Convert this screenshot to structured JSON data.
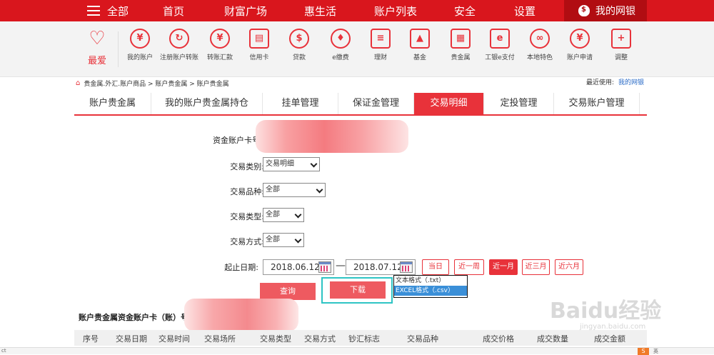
{
  "topnav": {
    "all_label": "全部",
    "items": [
      "首页",
      "财富广场",
      "惠生活",
      "账户列表",
      "安全",
      "设置"
    ],
    "mybank_label": "我的网银"
  },
  "quick": {
    "fav_label": "最爱",
    "items": [
      {
        "label": "我的账户",
        "icon": "yen-icon"
      },
      {
        "label": "注册账户转账",
        "icon": "transfer-icon"
      },
      {
        "label": "转账汇款",
        "icon": "remit-icon"
      },
      {
        "label": "信用卡",
        "icon": "credit-card-icon"
      },
      {
        "label": "贷款",
        "icon": "money-bag-icon"
      },
      {
        "label": "e缴费",
        "icon": "drop-icon"
      },
      {
        "label": "理财",
        "icon": "finance-icon"
      },
      {
        "label": "基金",
        "icon": "fund-chart-icon"
      },
      {
        "label": "贵金属",
        "icon": "gold-bars-icon"
      },
      {
        "label": "工银e支付",
        "icon": "epay-icon"
      },
      {
        "label": "本地特色",
        "icon": "local-icon"
      },
      {
        "label": "账户申请",
        "icon": "apply-icon"
      },
      {
        "label": "调整",
        "icon": "plus-icon"
      }
    ]
  },
  "breadcrumb": "贵金属.外汇.账户商品 > 账户贵金属 > 账户贵金属",
  "recent": {
    "label": "最近使用:",
    "link": "我的网银"
  },
  "tabs": [
    {
      "label": "账户贵金属",
      "active": false
    },
    {
      "label": "我的账户贵金属持仓",
      "active": false
    },
    {
      "label": "挂单管理",
      "active": false
    },
    {
      "label": "保证金管理",
      "active": false
    },
    {
      "label": "交易明细",
      "active": true
    },
    {
      "label": "定投管理",
      "active": false
    },
    {
      "label": "交易账户管理",
      "active": false
    }
  ],
  "form": {
    "account_label": "资金账户卡号",
    "trade_class_label": "交易类别:",
    "trade_class_value": "交易明细",
    "variety_label": "交易品种:",
    "variety_value": "全部",
    "trade_type_label": "交易类型:",
    "trade_type_value": "全部",
    "trade_method_label": "交易方式:",
    "trade_method_value": "全部",
    "date_label": "起止日期:",
    "start_date": "2018.06.12",
    "end_date": "2018.07.12",
    "date_sep": "—",
    "quick_ranges": [
      {
        "label": "当日",
        "active": false
      },
      {
        "label": "近一周",
        "active": false
      },
      {
        "label": "近一月",
        "active": true
      },
      {
        "label": "近三月",
        "active": false
      },
      {
        "label": "近六月",
        "active": false
      }
    ],
    "query_btn": "查询",
    "download_btn": "下载",
    "download_options": [
      "文本格式（.txt）",
      "EXCEL格式（.csv）"
    ],
    "download_selected": 1
  },
  "section_title": "账户贵金属资金账户卡（账）号",
  "table_headers": [
    "序号",
    "交易日期",
    "交易时间",
    "交易场所",
    "交易类型",
    "交易方式",
    "钞汇标志",
    "交易品种",
    "成交价格",
    "成交数量",
    "成交金额"
  ],
  "watermark": {
    "brand": "Baidu经验",
    "url": "jingyan.baidu.com"
  },
  "statusbar": {
    "left": "ct",
    "ime": "英"
  }
}
